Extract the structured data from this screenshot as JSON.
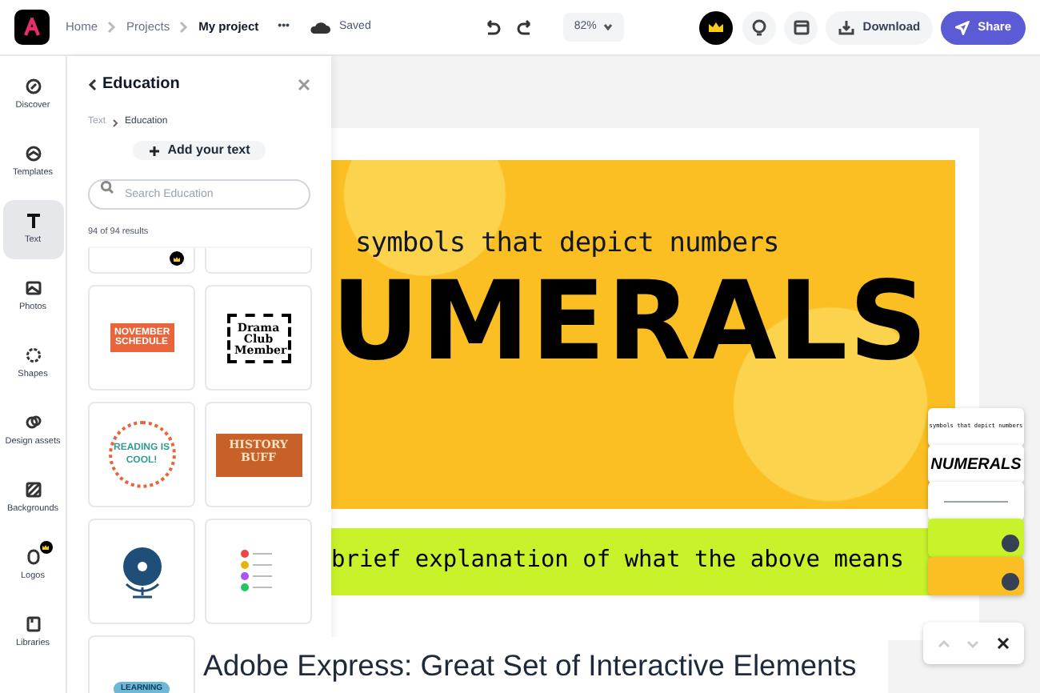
{
  "topbar": {
    "breadcrumb": [
      "Home",
      "Projects",
      "My project"
    ],
    "more": "•••",
    "save_status": "Saved",
    "zoom": "82%",
    "download": "Download",
    "share": "Share"
  },
  "sidebar": {
    "items": [
      {
        "label": "Discover",
        "selected": false,
        "premium": false
      },
      {
        "label": "Templates",
        "selected": false,
        "premium": false
      },
      {
        "label": "Text",
        "selected": true,
        "premium": false
      },
      {
        "label": "Photos",
        "selected": false,
        "premium": false
      },
      {
        "label": "Shapes",
        "selected": false,
        "premium": false
      },
      {
        "label": "Design assets",
        "selected": false,
        "premium": false
      },
      {
        "label": "Backgrounds",
        "selected": false,
        "premium": false
      },
      {
        "label": "Logos",
        "selected": false,
        "premium": true
      },
      {
        "label": "Libraries",
        "selected": false,
        "premium": false
      }
    ]
  },
  "panel": {
    "title": "Education",
    "breadcrumb": [
      "Text",
      "Education"
    ],
    "add_button": "Add your text",
    "search": {
      "placeholder": "Search Education"
    },
    "results": "94 of 94 results",
    "tiles": [
      {
        "kind": "blank",
        "premium": true
      },
      {
        "kind": "blank",
        "premium": false
      },
      {
        "kind": "schedule",
        "text": "NOVEMBER SCHEDULE",
        "premium": false
      },
      {
        "kind": "stamp",
        "text": "Drama Club Member",
        "premium": false
      },
      {
        "kind": "circle",
        "text": "READING IS COOL!",
        "premium": false
      },
      {
        "kind": "plaque",
        "text": "HISTORY BUFF",
        "premium": false
      },
      {
        "kind": "globe",
        "premium": false
      },
      {
        "kind": "list",
        "premium": false
      },
      {
        "kind": "banner",
        "text": "LEARNING",
        "premium": false
      }
    ]
  },
  "canvas": {
    "subtitle": "symbols that depict numbers",
    "headline": "UMERALS",
    "band_text": "brief explanation of what the above means"
  },
  "pages": [
    {
      "kind": "text",
      "text": "symbols that depict numbers"
    },
    {
      "kind": "heading",
      "text": "NUMERALS"
    },
    {
      "kind": "lines"
    },
    {
      "kind": "color",
      "color": "#c8f32a"
    },
    {
      "kind": "image",
      "color": "#fbbf24"
    }
  ],
  "page_nav": {
    "up_disabled": true,
    "down_disabled": true
  },
  "caption": "Adobe Express: Great Set of Interactive Elements"
}
